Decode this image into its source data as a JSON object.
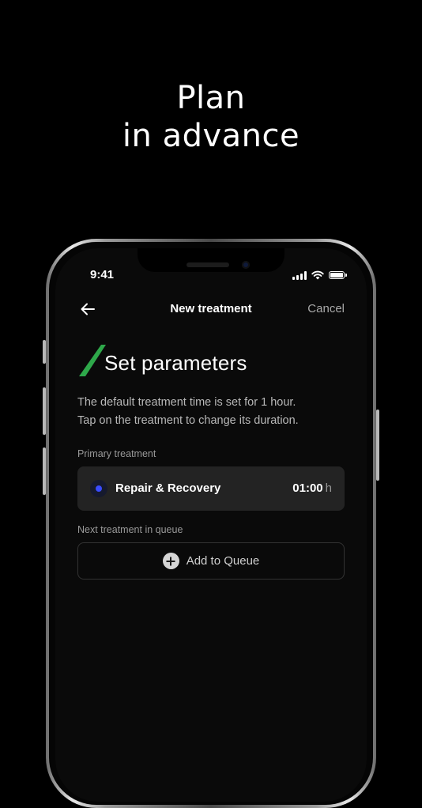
{
  "headline": {
    "line1": "Plan",
    "line2": "in advance"
  },
  "status_bar": {
    "time": "9:41"
  },
  "nav": {
    "title": "New treatment",
    "cancel_label": "Cancel"
  },
  "section": {
    "title": "Set parameters",
    "description_line1": "The default treatment time is set for 1 hour.",
    "description_line2": "Tap on the treatment to change its duration."
  },
  "primary": {
    "label": "Primary treatment",
    "name": "Repair & Recovery",
    "duration": "01:00",
    "unit": "h"
  },
  "queue": {
    "label": "Next treatment in queue",
    "add_label": "Add to Queue"
  },
  "colors": {
    "background": "#000000",
    "accent_green": "#2ea84a",
    "dot_blue": "#3a4cff",
    "card": "#232323"
  }
}
